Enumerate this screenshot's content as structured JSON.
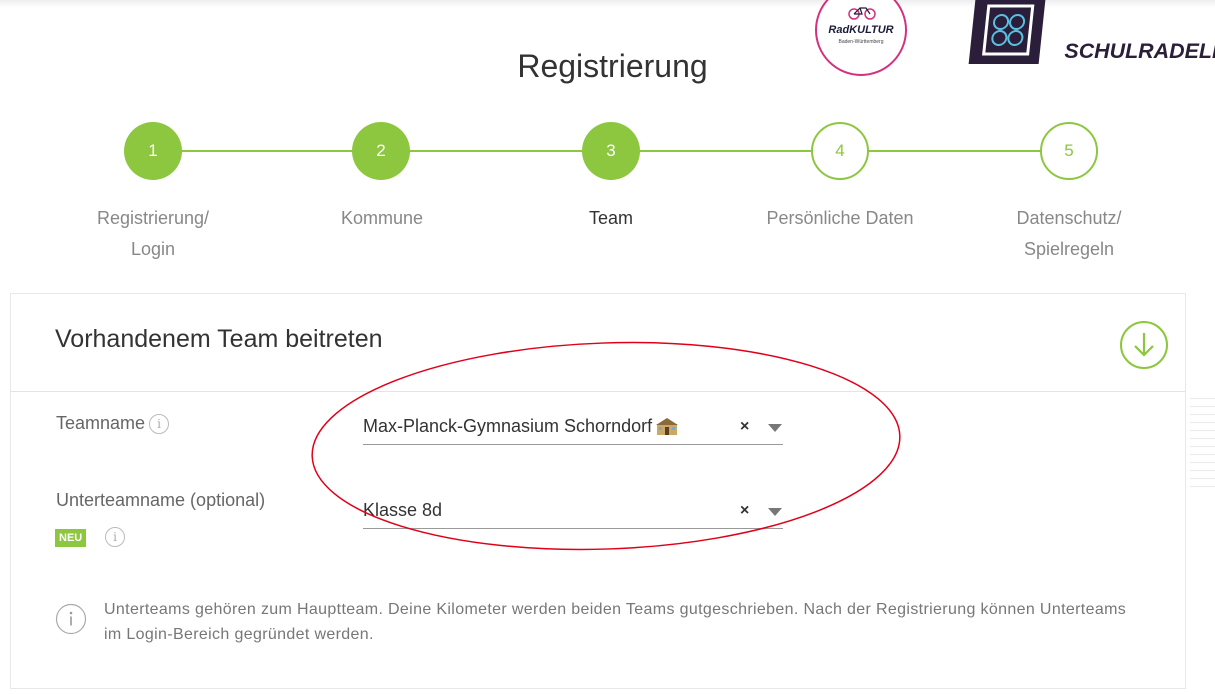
{
  "header": {
    "title": "Registrierung",
    "logos": {
      "radkultur": {
        "name": "RadKULTUR",
        "subtitle": "Baden-Württemberg"
      },
      "schulradeln": {
        "name": "SCHULRADELN"
      }
    }
  },
  "stepper": {
    "steps": [
      {
        "number": "1",
        "label": "Registrierung/\nLogin",
        "state": "done"
      },
      {
        "number": "2",
        "label": "Kommune",
        "state": "done"
      },
      {
        "number": "3",
        "label": "Team",
        "state": "active"
      },
      {
        "number": "4",
        "label": "Persönliche Daten",
        "state": "todo"
      },
      {
        "number": "5",
        "label": "Datenschutz/\nSpielregeln",
        "state": "todo"
      }
    ]
  },
  "card": {
    "title": "Vorhandenem Team beitreten",
    "team_field": {
      "label": "Teamname",
      "value": "Max-Planck-Gymnasium Schorndorf",
      "value_icon": "school-building-icon",
      "clear_glyph": "×"
    },
    "subteam_field": {
      "label": "Unterteamname (optional)",
      "badge": "NEU",
      "value": "Klasse 8d",
      "clear_glyph": "×"
    },
    "hint": "Unterteams gehören zum Hauptteam. Deine Kilometer werden beiden Teams gutgeschrieben. Nach der Registrierung können Unterteams im Login-Bereich gegründet werden."
  },
  "colors": {
    "accent": "#8dc63f",
    "annotation": "#e0001a",
    "brand_dark": "#2a1e3a",
    "brand_pink": "#d4307e"
  },
  "info_glyph": "i"
}
